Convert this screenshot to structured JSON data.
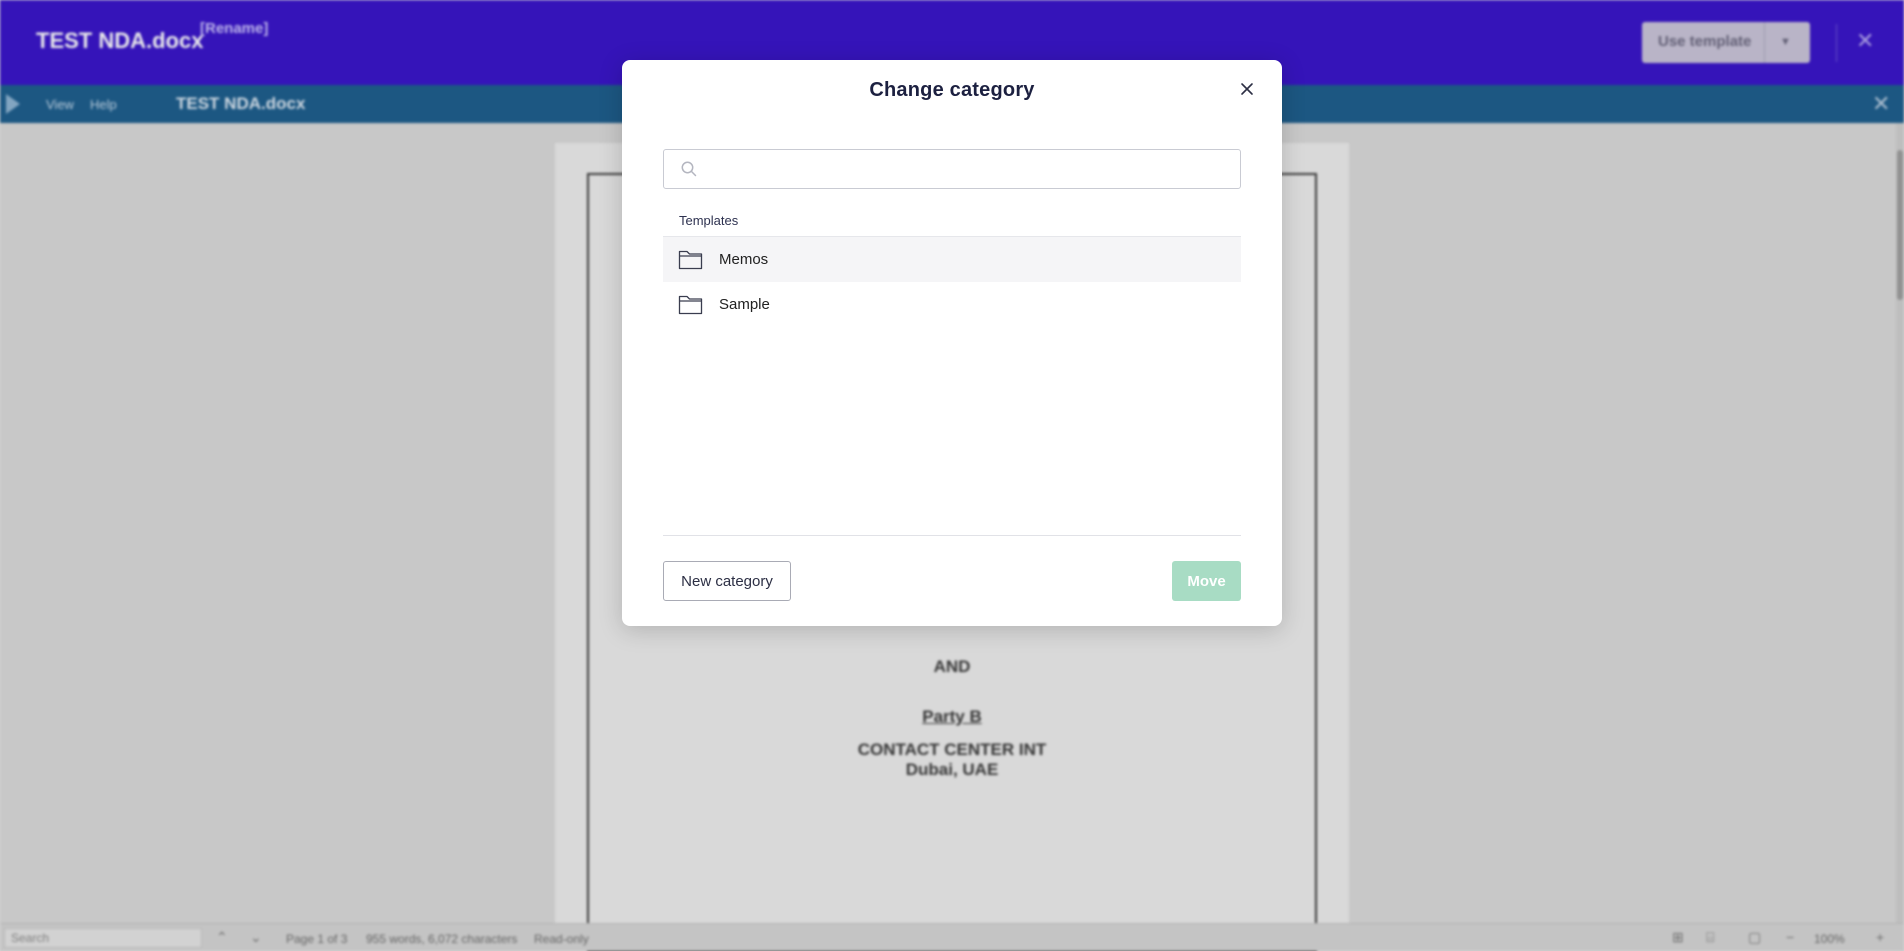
{
  "app": {
    "doc_title": "TEST NDA.docx",
    "rename_label": "[Rename]",
    "use_template_label": "Use template",
    "menu": {
      "items": [
        "View",
        "Help"
      ],
      "doc_name": "TEST NDA.docx"
    },
    "document": {
      "and_text": "AND",
      "party_b": "Party B",
      "company": "CONTACT CENTER INT",
      "location": "Dubai, UAE"
    },
    "statusbar": {
      "search_placeholder": "Search",
      "page_info": "Page 1 of 3",
      "word_count": "955 words, 6,072 characters",
      "mode": "Read-only",
      "zoom": "100%"
    }
  },
  "modal": {
    "title": "Change category",
    "search": {
      "value": "",
      "placeholder": ""
    },
    "section_label": "Templates",
    "categories": [
      {
        "label": "Memos",
        "icon": "folder-icon"
      },
      {
        "label": "Sample",
        "icon": "folder-icon"
      }
    ],
    "new_category_label": "New category",
    "move_label": "Move",
    "colors": {
      "primary_header": "#3a16c9",
      "menubar": "#1f5f8e",
      "move_disabled": "#a8dcc4"
    }
  }
}
